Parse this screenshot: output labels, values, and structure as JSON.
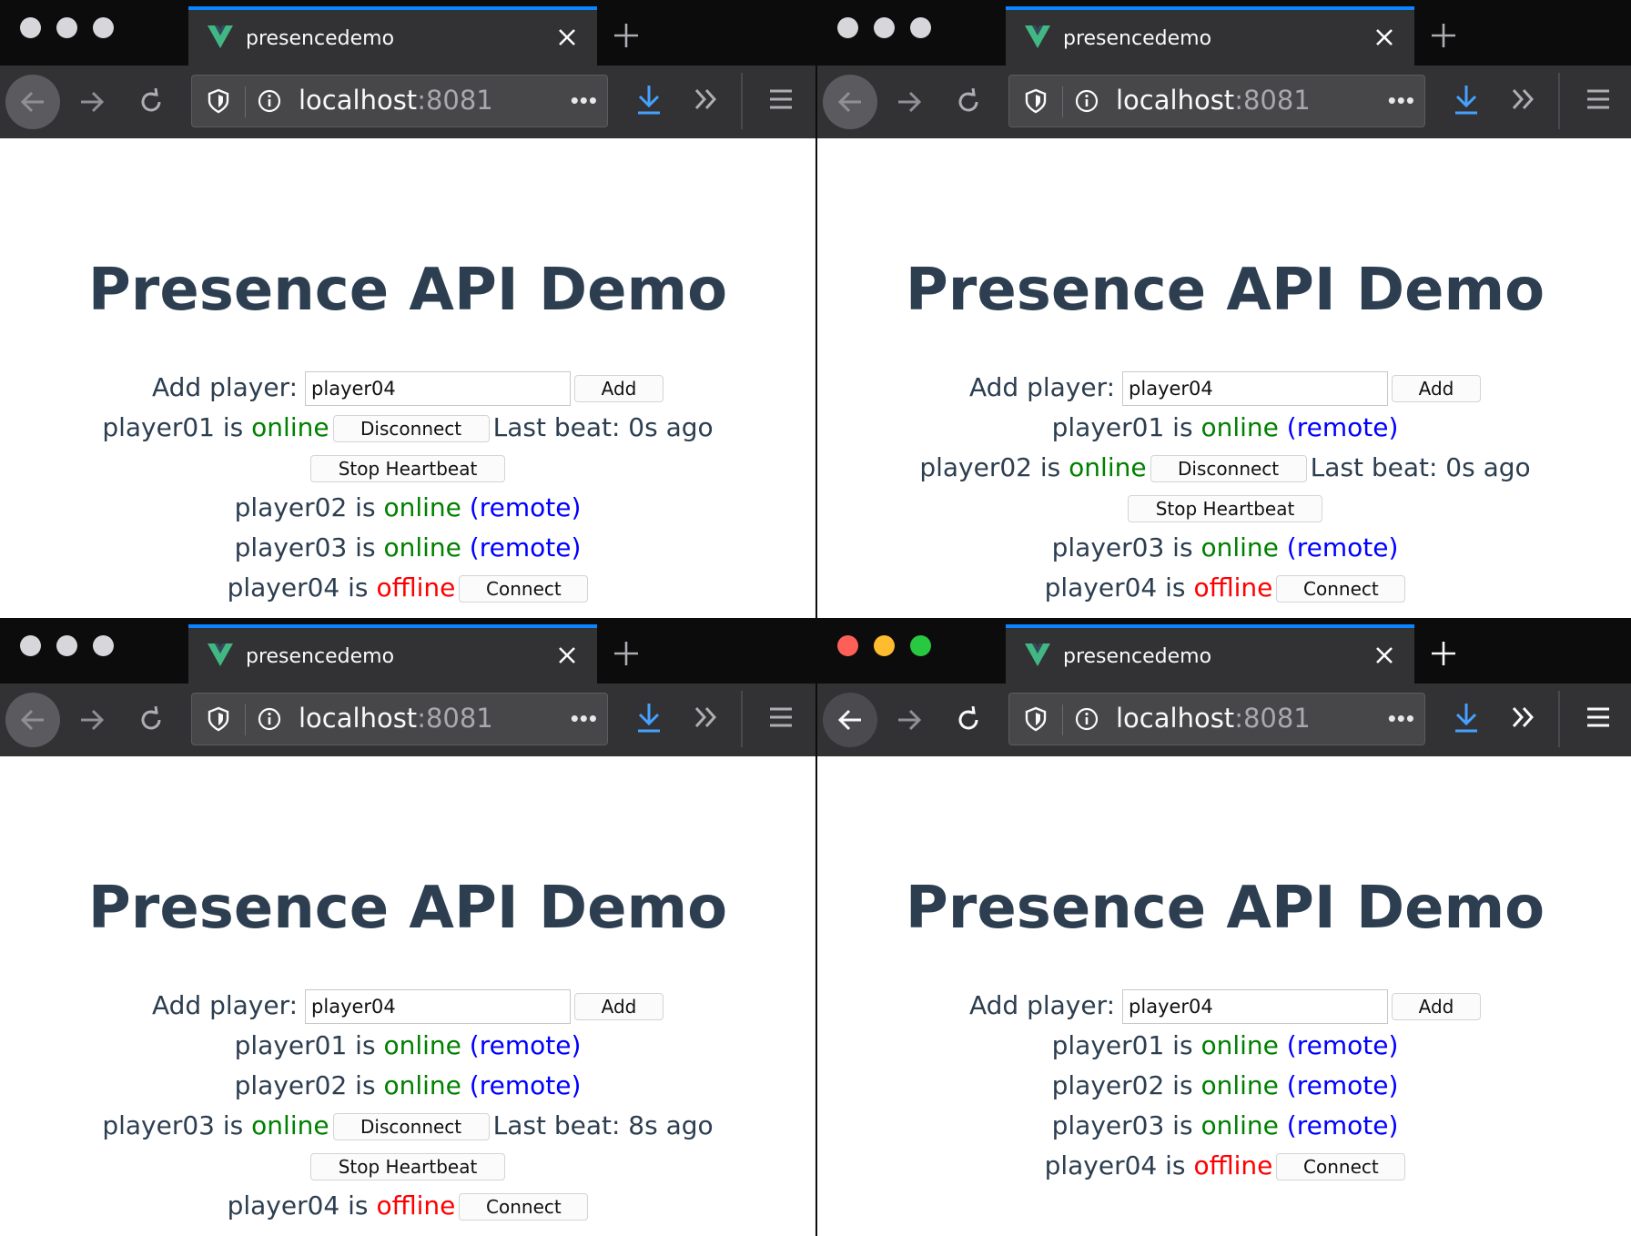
{
  "browser": {
    "tab_title": "presencedemo",
    "url_host": "localhost",
    "url_port": ":8081",
    "url_more": "•••"
  },
  "app": {
    "heading": "Presence API Demo",
    "add_label": "Add player:",
    "add_button": "Add",
    "disconnect_button": "Disconnect",
    "connect_button": "Connect",
    "stop_heartbeat_button": "Stop Heartbeat",
    "is_text": "is",
    "online_text": "online",
    "offline_text": "offline",
    "remote_text": "(remote)"
  },
  "windows": [
    {
      "input_value": "player04",
      "players": [
        {
          "name": "player01",
          "status": "online",
          "local": true,
          "beat": "Last beat: 0s ago"
        },
        {
          "name": "player02",
          "status": "online",
          "local": false
        },
        {
          "name": "player03",
          "status": "online",
          "local": false
        },
        {
          "name": "player04",
          "status": "offline"
        }
      ]
    },
    {
      "input_value": "player04",
      "players": [
        {
          "name": "player01",
          "status": "online",
          "local": false
        },
        {
          "name": "player02",
          "status": "online",
          "local": true,
          "beat": "Last beat: 0s ago"
        },
        {
          "name": "player03",
          "status": "online",
          "local": false
        },
        {
          "name": "player04",
          "status": "offline"
        }
      ]
    },
    {
      "input_value": "player04",
      "players": [
        {
          "name": "player01",
          "status": "online",
          "local": false
        },
        {
          "name": "player02",
          "status": "online",
          "local": false
        },
        {
          "name": "player03",
          "status": "online",
          "local": true,
          "beat": "Last beat: 8s ago"
        },
        {
          "name": "player04",
          "status": "offline"
        }
      ]
    },
    {
      "input_value": "player04",
      "players": [
        {
          "name": "player01",
          "status": "online",
          "local": false
        },
        {
          "name": "player02",
          "status": "online",
          "local": false
        },
        {
          "name": "player03",
          "status": "online",
          "local": false
        },
        {
          "name": "player04",
          "status": "offline"
        }
      ]
    }
  ],
  "colors": {
    "heading": "#2c3e50",
    "online": "#008000",
    "offline": "#ff0000",
    "remote": "#0000ff",
    "tab_accent": "#0a84ff",
    "download_icon": "#45a1ff"
  },
  "icons": [
    "vue-logo-icon",
    "close-icon",
    "plus-icon",
    "back-arrow-icon",
    "forward-arrow-icon",
    "reload-icon",
    "shield-icon",
    "info-icon",
    "download-icon",
    "overflow-chevrons-icon",
    "hamburger-menu-icon"
  ]
}
